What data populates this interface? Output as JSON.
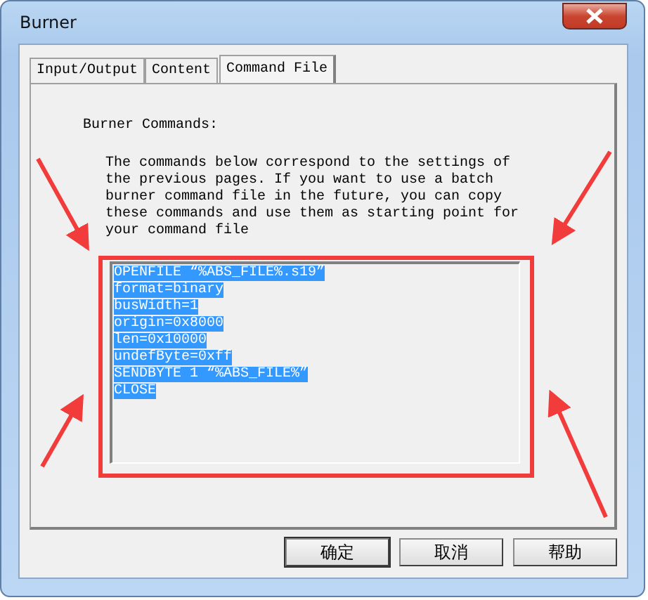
{
  "window": {
    "title": "Burner"
  },
  "tabs": [
    {
      "label": "Input/Output",
      "selected": false
    },
    {
      "label": "Content",
      "selected": false
    },
    {
      "label": "Command File",
      "selected": true
    }
  ],
  "page": {
    "heading": "Burner Commands:",
    "description": [
      "The commands below correspond to the settings of",
      "the previous pages. If you want to use a batch",
      "burner command file in the future, you can copy",
      "these commands and use them as starting point for",
      "your command file"
    ],
    "commands": [
      {
        "text": "OPENFILE “%ABS_FILE%.s19”",
        "selected": true
      },
      {
        "text": "format=binary",
        "selected": true
      },
      {
        "text": "busWidth=1",
        "selected": true
      },
      {
        "text": "origin=0x8000",
        "selected": true
      },
      {
        "text": "len=0x10000",
        "selected": true
      },
      {
        "text": "undefByte=0xff",
        "selected": true
      },
      {
        "text": "SENDBYTE 1 “%ABS_FILE%”",
        "selected": true
      },
      {
        "text": "CLOSE",
        "selected": true
      }
    ]
  },
  "buttons": [
    "确定",
    "取消",
    "帮助"
  ]
}
